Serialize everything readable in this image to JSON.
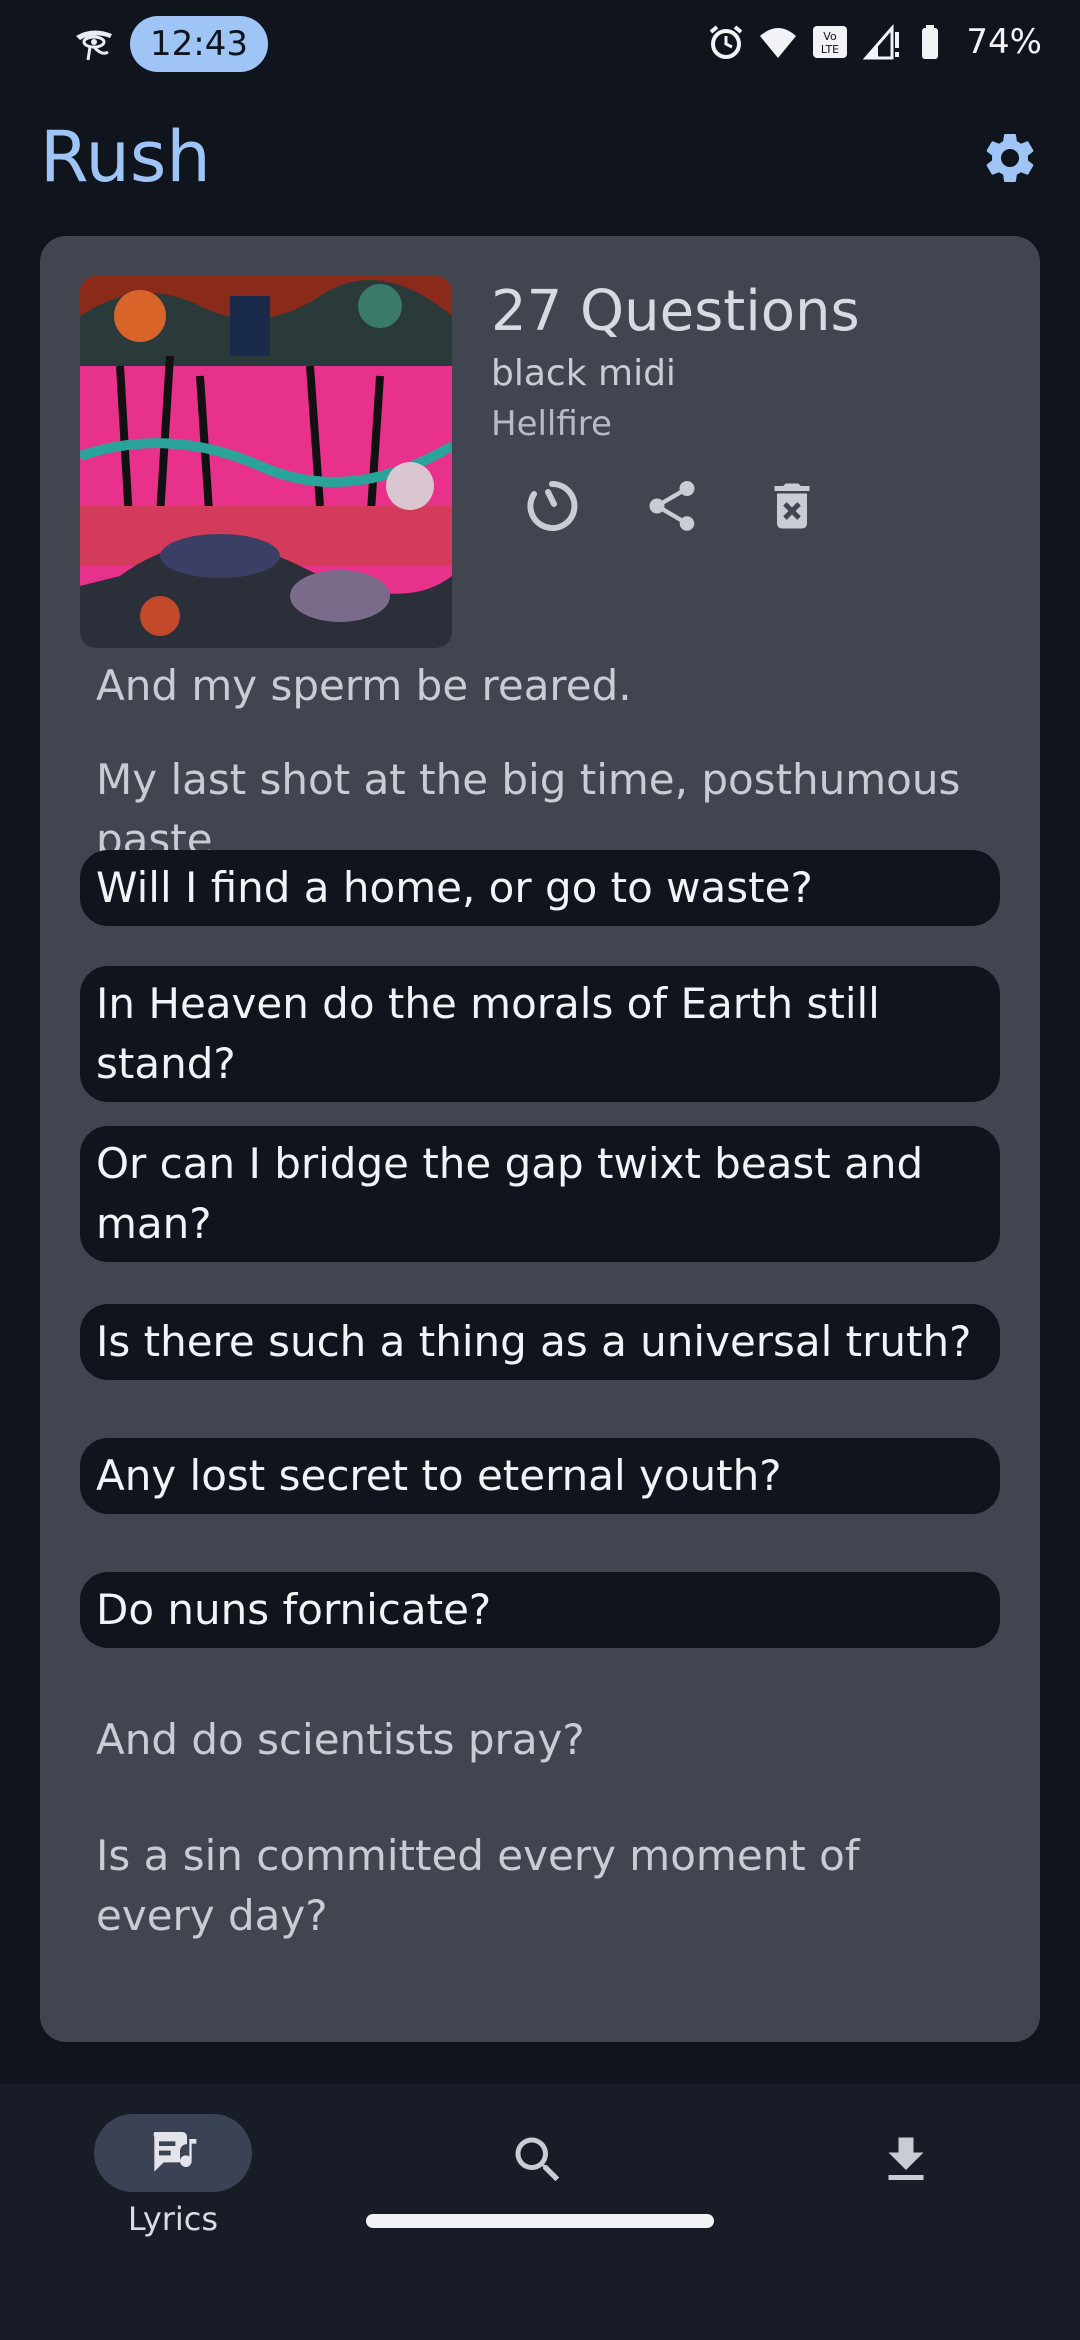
{
  "status_bar": {
    "time": "12:43",
    "battery": "74%",
    "icons": [
      "eye-of-horus-icon",
      "alarm-icon",
      "wifi-icon",
      "volte-icon",
      "signal-icon",
      "battery-icon"
    ]
  },
  "header": {
    "title": "Rush",
    "settings_icon": "gear-icon",
    "accent": "#9ec5f5"
  },
  "song": {
    "title": "27 Questions",
    "artist": "black midi",
    "album": "Hellfire",
    "actions": [
      "sync-icon",
      "share-icon",
      "delete-icon"
    ]
  },
  "lyrics": [
    {
      "text": "And my sperm be reared.",
      "highlighted": false
    },
    {
      "text": "My last shot at the big time, posthumous paste",
      "highlighted": false
    },
    {
      "text": "Will I find a home, or go to waste?",
      "highlighted": true
    },
    {
      "text": "In Heaven do the morals of Earth still stand?",
      "highlighted": true
    },
    {
      "text": "Or can I bridge the gap twixt beast and man?",
      "highlighted": true
    },
    {
      "text": "Is there such a thing as a universal truth?",
      "highlighted": true
    },
    {
      "text": "Any lost secret to eternal youth?",
      "highlighted": true
    },
    {
      "text": "Do nuns fornicate?",
      "highlighted": true
    },
    {
      "text": "And do scientists pray?",
      "highlighted": false
    },
    {
      "text": "Is a sin committed every moment of every day?",
      "highlighted": false
    }
  ],
  "bottom_nav": {
    "lyrics_label": "Lyrics",
    "items": [
      "lyrics-icon",
      "search-icon",
      "download-icon"
    ]
  }
}
